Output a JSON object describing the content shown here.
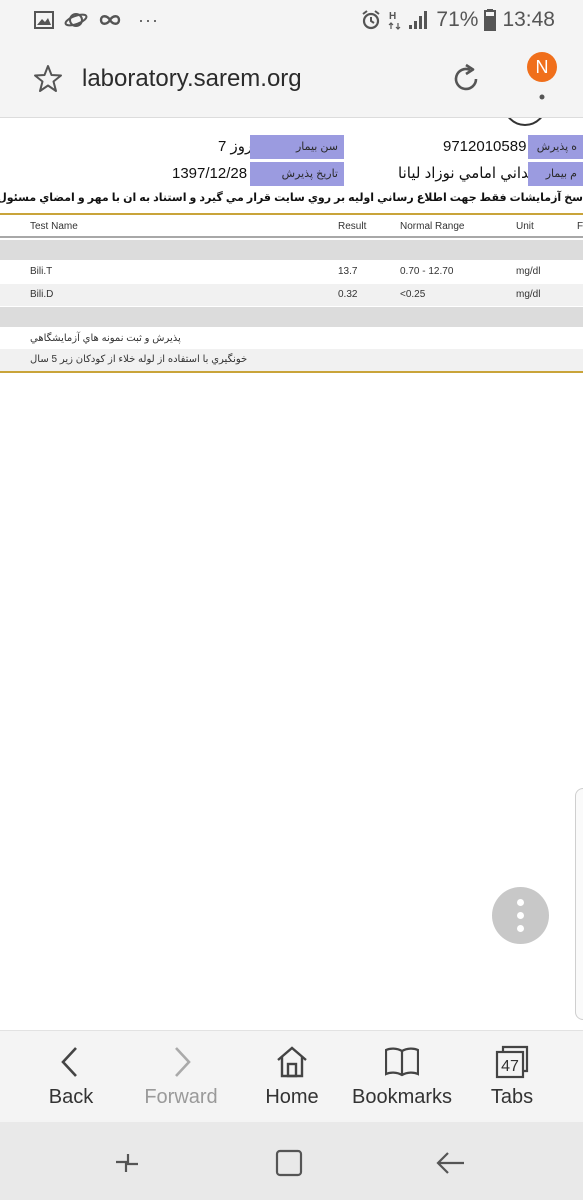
{
  "status_bar": {
    "left_icons": [
      "image-icon",
      "saturn-icon",
      "infinity-icon"
    ],
    "more_label": "···",
    "right_icons": [
      "alarm-icon",
      "data-h-icon",
      "signal-icon",
      "battery-icon"
    ],
    "battery_percent": "71%",
    "time": "13:48"
  },
  "url_bar": {
    "url": "laboratory.sarem.org",
    "notification_badge": "N",
    "badge_color": "#f06f1b"
  },
  "patient_info": {
    "age_label": "سن بيمار",
    "age_value": "روز 7",
    "admission_no_label": "ه پذيرش",
    "admission_no_value": "9712010589",
    "date_label": "تاريخ پذيرش",
    "date_value": "1397/12/28",
    "name_label": "م بيمار",
    "name_value": "وجداني امامي نوزاد ليانا",
    "label_bg_color": "#9b9be0"
  },
  "disclaimer": "سخ آزمايشات فقط جهت اطلاع رساني اوليه بر روي سايت قرار مي گيرد و استناد به ان با مهر و امضاي مسئول فني آزمايشگاه معتبر و",
  "results_table": {
    "headers": [
      "Test Name",
      "Result",
      "Normal Range",
      "Unit",
      "F"
    ],
    "rows": [
      {
        "test": "Bili.T",
        "result": "13.7",
        "range": "0.70 - 12.70",
        "unit": "mg/dl"
      },
      {
        "test": "Bili.D",
        "result": "0.32",
        "range": "<0.25",
        "unit": "mg/dl"
      }
    ]
  },
  "notes": [
    "پذيرش و ثبت نمونه هاي آزمايشگاهي",
    "خونگيري با استفاده از لوله خلاء از كودكان زير 5 سال"
  ],
  "toolbar": {
    "back": "Back",
    "forward": "Forward",
    "home": "Home",
    "bookmarks": "Bookmarks",
    "tabs": "Tabs",
    "tabs_count": "47"
  },
  "nav_bar": {
    "icons": [
      "recent-apps-icon",
      "home-square-icon",
      "back-arrow-icon"
    ]
  }
}
